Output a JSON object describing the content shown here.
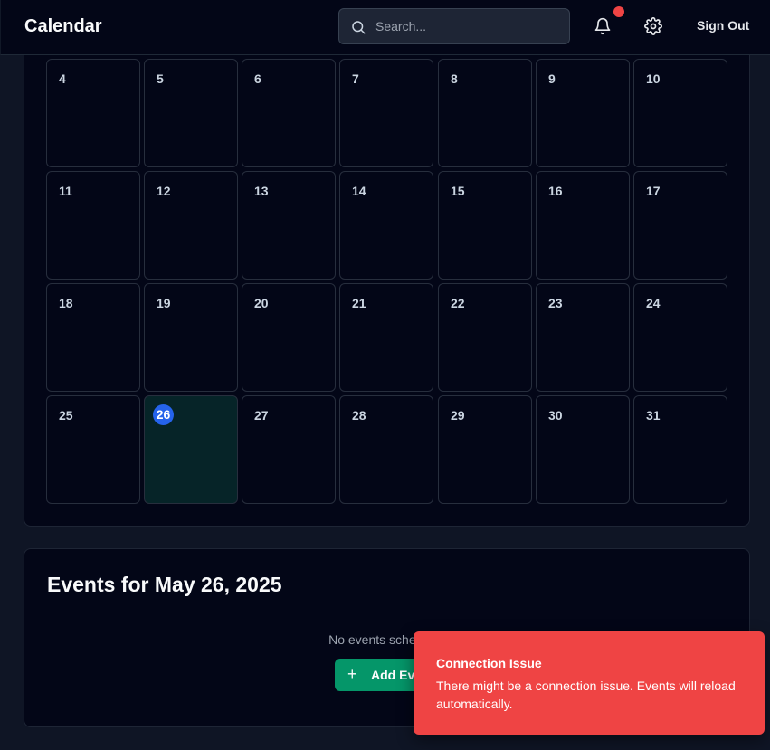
{
  "header": {
    "title": "Calendar",
    "search_placeholder": "Search...",
    "sign_out_label": "Sign Out",
    "has_notification": true
  },
  "calendar": {
    "weeks": [
      [
        "4",
        "5",
        "6",
        "7",
        "8",
        "9",
        "10"
      ],
      [
        "11",
        "12",
        "13",
        "14",
        "15",
        "16",
        "17"
      ],
      [
        "18",
        "19",
        "20",
        "21",
        "22",
        "23",
        "24"
      ],
      [
        "25",
        "26",
        "27",
        "28",
        "29",
        "30",
        "31"
      ]
    ],
    "today": "26"
  },
  "events": {
    "title": "Events for May 26, 2025",
    "empty_text": "No events scheduled",
    "add_label": "Add Event"
  },
  "toast": {
    "title": "Connection Issue",
    "message": "There might be a connection issue. Events will reload automatically."
  },
  "colors": {
    "accent": "#2563eb",
    "add_button": "#059669",
    "toast_bg": "#ef4444",
    "notification_dot": "#ef4444",
    "today_cell": "#062428"
  }
}
